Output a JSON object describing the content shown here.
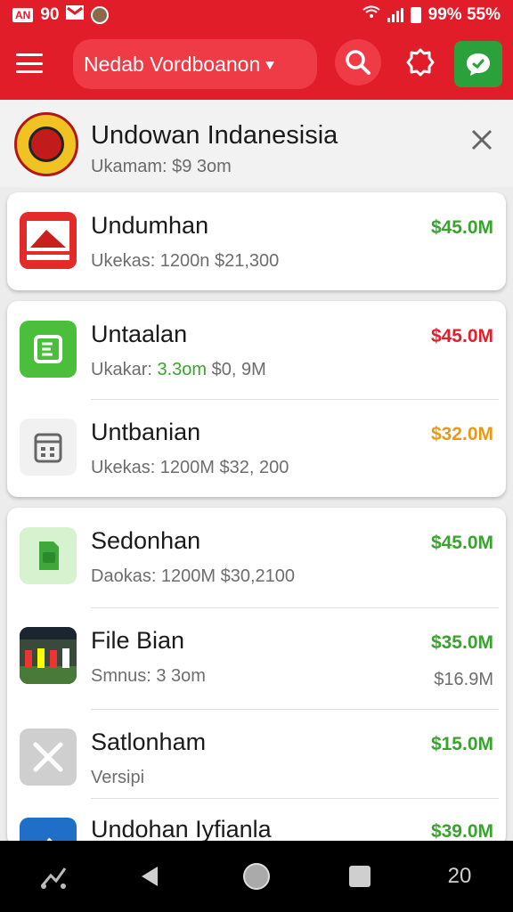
{
  "status_bar": {
    "left_label": "AN",
    "time": "90",
    "right_text": "99% 55%",
    "colors": {
      "background": "#e21d2a"
    }
  },
  "app_bar": {
    "search_text": "Nedab Vordboanon",
    "icons": [
      "menu-icon",
      "search-icon",
      "gear-icon",
      "chat-icon"
    ],
    "accent_green": "#2aa13a"
  },
  "banner": {
    "title": "Undowan Indanesisia",
    "subtitle": "Ukamam: $9 3om"
  },
  "cards": [
    {
      "items": [
        {
          "title": "Undumhan",
          "subtitle": "Ukekas: 1200n $21,300",
          "price": "$45.0M",
          "price_color": "#3aa32e",
          "icon": "red-app-icon"
        }
      ]
    },
    {
      "items": [
        {
          "title": "Untaalan",
          "subtitle_prefix": "Ukakar: ",
          "subtitle_highlight": "3.3om",
          "subtitle_rest": " $0, 9M",
          "price": "$45.0M",
          "price_color": "#e0202a",
          "icon": "green-e-app-icon"
        },
        {
          "title": "Untbanian",
          "subtitle": "Ukekas: 1200M $32, 200",
          "price": "$32.0M",
          "price_color": "#e69a1a",
          "icon": "calculator-icon"
        }
      ]
    },
    {
      "items": [
        {
          "title": "Sedonhan",
          "subtitle": "Daokas: 1200M $30,2100",
          "price": "$45.0M",
          "price_color": "#3aa32e",
          "icon": "green-file-icon"
        },
        {
          "title": "File Bian",
          "subtitle": "Smnus: 3 3om",
          "price": "$35.0M",
          "price_color": "#3aa32e",
          "price_secondary": "$16.9M",
          "icon": "photo-thumbnail"
        },
        {
          "title": "Satlonham",
          "subtitle": "Versipi",
          "price": "$15.0M",
          "price_color": "#3aa32e",
          "icon": "tools-icon"
        },
        {
          "title": "Undohan Iyfianla",
          "subtitle": "",
          "price": "$39.0M",
          "price_color": "#3aa32e",
          "icon": "blue-app-icon"
        }
      ]
    }
  ],
  "nav_bar": {
    "icons": [
      "signal-icon",
      "back-icon",
      "home-icon",
      "recents-icon",
      "apps-icon"
    ],
    "apps_label": "20"
  }
}
